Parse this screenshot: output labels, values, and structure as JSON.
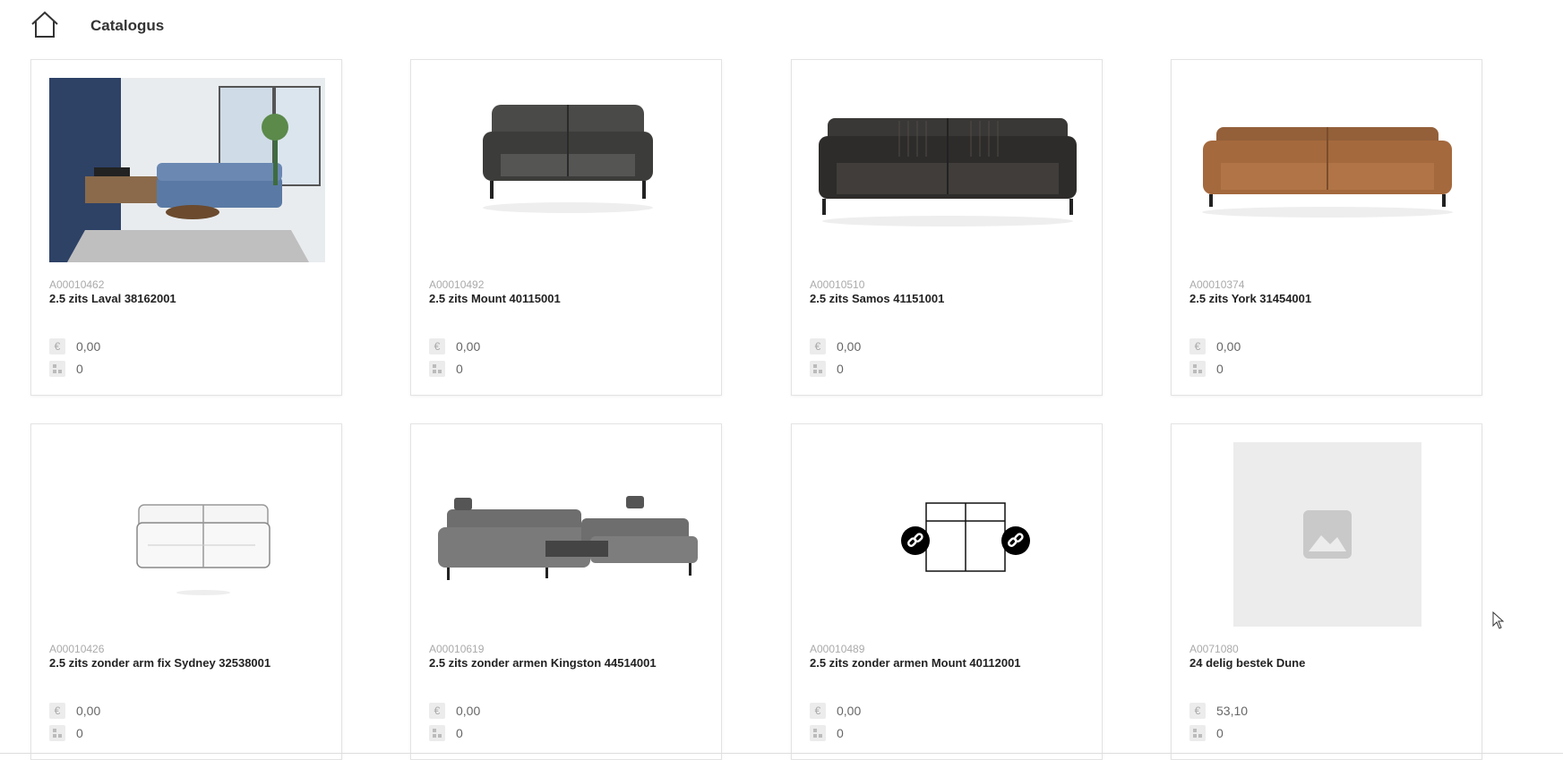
{
  "header": {
    "title": "Catalogus",
    "home_icon": "home-icon"
  },
  "products": [
    {
      "code": "A00010462",
      "name": "2.5 zits Laval 38162001",
      "price": "0,00",
      "stock": "0",
      "image": "living-room-photo"
    },
    {
      "code": "A00010492",
      "name": "2.5 zits Mount 40115001",
      "price": "0,00",
      "stock": "0",
      "image": "dark-grey-sofa"
    },
    {
      "code": "A00010510",
      "name": "2.5 zits Samos 41151001",
      "price": "0,00",
      "stock": "0",
      "image": "black-leather-sofa"
    },
    {
      "code": "A00010374",
      "name": "2.5 zits York 31454001",
      "price": "0,00",
      "stock": "0",
      "image": "brown-leather-sofa"
    },
    {
      "code": "A00010426",
      "name": "2.5 zits zonder arm fix Sydney 32538001",
      "price": "0,00",
      "stock": "0",
      "image": "white-sofa-sketch"
    },
    {
      "code": "A00010619",
      "name": "2.5 zits zonder armen Kingston 44514001",
      "price": "0,00",
      "stock": "0",
      "image": "grey-corner-sofa"
    },
    {
      "code": "A00010489",
      "name": "2.5 zits zonder armen Mount 40112001",
      "price": "0,00",
      "stock": "0",
      "image": "module-diagram"
    },
    {
      "code": "A0071080",
      "name": "24 delig bestek Dune",
      "price": "53,10",
      "stock": "0",
      "image": "image-placeholder"
    }
  ],
  "icons": {
    "price": "euro-icon",
    "stock": "stock-icon"
  },
  "colors": {
    "accent_text": "#222222",
    "muted_text": "#aaaaaa",
    "icon_bg": "#ececec"
  }
}
